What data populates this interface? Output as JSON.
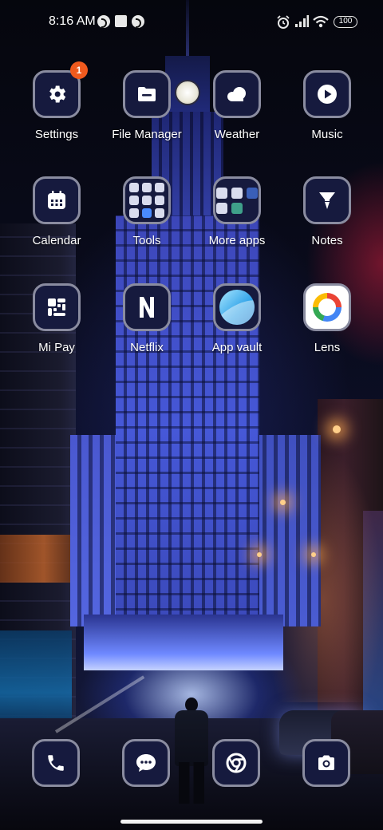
{
  "status_bar": {
    "time": "8:16 AM",
    "battery": "100",
    "left_icons": [
      "app-notification-icon",
      "square-notification-icon",
      "app-notification-icon"
    ],
    "right_icons": [
      "alarm-icon",
      "signal-icon",
      "wifi-icon",
      "battery-icon"
    ]
  },
  "apps": [
    {
      "label": "Settings",
      "icon": "gear-icon",
      "badge": "1"
    },
    {
      "label": "File Manager",
      "icon": "folder-icon"
    },
    {
      "label": "Weather",
      "icon": "cloud-icon"
    },
    {
      "label": "Music",
      "icon": "play-icon"
    },
    {
      "label": "Calendar",
      "icon": "calendar-icon"
    },
    {
      "label": "Tools",
      "icon": "folder-grid-icon"
    },
    {
      "label": "More apps",
      "icon": "folder-grid-icon"
    },
    {
      "label": "Notes",
      "icon": "notes-icon"
    },
    {
      "label": "Mi Pay",
      "icon": "mi-pay-icon"
    },
    {
      "label": "Netflix",
      "icon": "netflix-icon"
    },
    {
      "label": "App vault",
      "icon": "app-vault-icon"
    },
    {
      "label": "Lens",
      "icon": "lens-icon"
    }
  ],
  "dock": [
    {
      "icon": "phone-icon"
    },
    {
      "icon": "messages-icon"
    },
    {
      "icon": "chrome-icon"
    },
    {
      "icon": "camera-icon"
    }
  ],
  "colors": {
    "tile_bg": "#161a3e",
    "tile_border": "#8a8ca0",
    "badge": "#f05a1e"
  }
}
